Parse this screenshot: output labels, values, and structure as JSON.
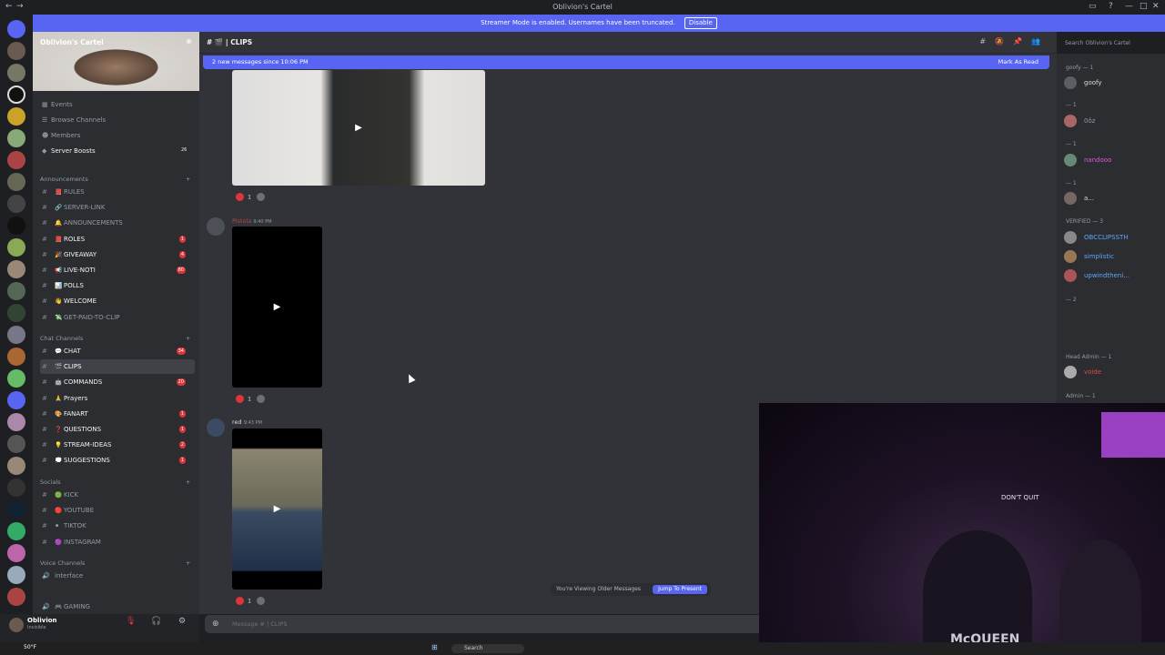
{
  "window": {
    "title": "Oblivion's Cartel"
  },
  "banner": {
    "text": "Streamer Mode is enabled. Usernames have been truncated.",
    "button": "Disable"
  },
  "server": {
    "name": "Oblivion's Cartel"
  },
  "server_menu": [
    {
      "label": "Events",
      "badge": ""
    },
    {
      "label": "Browse Channels",
      "badge": ""
    },
    {
      "label": "Members",
      "badge": ""
    },
    {
      "label": "Server Boosts",
      "badge": "26"
    }
  ],
  "categories": {
    "announcements": "Announcements",
    "chat": "Chat Channels",
    "socials": "Socials",
    "voice": "Voice Channels"
  },
  "channels_announcements": [
    {
      "emoji": "📕",
      "label": "RULES",
      "badge": ""
    },
    {
      "emoji": "🔗",
      "label": "SERVER-LINK",
      "badge": ""
    },
    {
      "emoji": "🔔",
      "label": "ANNOUNCEMENTS",
      "badge": ""
    },
    {
      "emoji": "📕",
      "label": "ROLES",
      "badge": "1"
    },
    {
      "emoji": "🎉",
      "label": "GIVEAWAY",
      "badge": "4"
    },
    {
      "emoji": "📢",
      "label": "LIVE-NOTI",
      "badge": "80"
    },
    {
      "emoji": "📊",
      "label": "POLLS",
      "badge": ""
    },
    {
      "emoji": "👋",
      "label": "WELCOME",
      "badge": ""
    },
    {
      "emoji": "💸",
      "label": "GET-PAID-TO-CLIP",
      "badge": ""
    }
  ],
  "channels_chat": [
    {
      "emoji": "💬",
      "label": "CHAT",
      "badge": "34"
    },
    {
      "emoji": "🎬",
      "label": "CLIPS",
      "badge": ""
    },
    {
      "emoji": "🤖",
      "label": "COMMANDS",
      "badge": "20"
    },
    {
      "emoji": "🙏",
      "label": "Prayers",
      "badge": ""
    },
    {
      "emoji": "🎨",
      "label": "FANART",
      "badge": "1"
    },
    {
      "emoji": "❓",
      "label": "QUESTIONS",
      "badge": "1"
    },
    {
      "emoji": "💡",
      "label": "STREAM-IDEAS",
      "badge": "2"
    },
    {
      "emoji": "💭",
      "label": "SUGGESTIONS",
      "badge": "1"
    }
  ],
  "channels_socials": [
    {
      "emoji": "🟢",
      "label": "KICK"
    },
    {
      "emoji": "🔴",
      "label": "YOUTUBE"
    },
    {
      "emoji": "⚫",
      "label": "TIKTOK"
    },
    {
      "emoji": "🟣",
      "label": "INSTAGRAM"
    }
  ],
  "channels_voice": [
    {
      "label": "interface"
    },
    {
      "label": "GAMING"
    }
  ],
  "user": {
    "name": "Oblivion",
    "status": "Invisible"
  },
  "channel_header": {
    "name": "| CLIPS"
  },
  "search_placeholder": "Search Oblivion's Cartel",
  "new_messages": {
    "text": "2 new messages since 10:06 PM",
    "mark": "Mark As Read"
  },
  "messages": [
    {
      "author": "",
      "time": "",
      "reaction_count": "1"
    },
    {
      "author": "Pistola",
      "time": "9:40 PM",
      "reaction_count": "1"
    },
    {
      "author": "red",
      "time": "9:43 PM",
      "reaction_count": "1"
    }
  ],
  "older_bar": {
    "text": "You're Viewing Older Messages",
    "button": "Jump To Present"
  },
  "composer": {
    "placeholder": "Message # | CLIPS"
  },
  "members": {
    "goofy_cat": "goofy — 1",
    "goofy": "goofy",
    "cat2": "— 1",
    "m2": "0ôz",
    "cat3": "— 1",
    "m3": "nandooo",
    "cat4": "— 1",
    "m4": "a...",
    "verified": "VERIFIED — 3",
    "v1": "OBCCLIPSSTH",
    "v2": "simplistic",
    "v3": "upwindtheni...",
    "cat6": "— 2",
    "head_admin": "Head Admin — 1",
    "ha1": "voide",
    "admin": "Admin — 1"
  },
  "taskbar": {
    "temp": "50°F",
    "search": "Search"
  },
  "webcam": {
    "sign": "DON'T QUIT",
    "shirt": "McQUEEN"
  }
}
